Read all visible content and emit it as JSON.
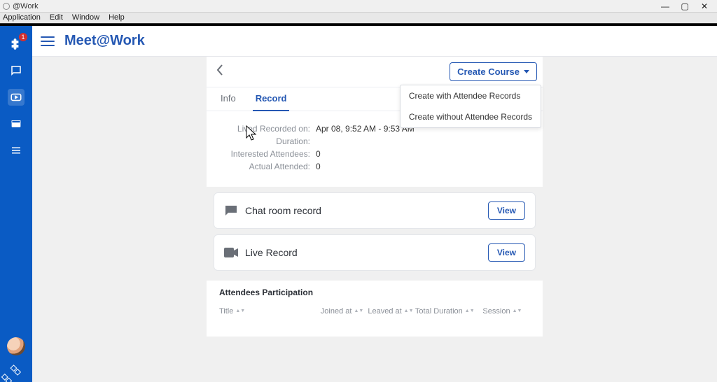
{
  "window": {
    "title": "@Work"
  },
  "menu": {
    "items": [
      "Application",
      "Edit",
      "Window",
      "Help"
    ]
  },
  "leftbar": {
    "badge": "1"
  },
  "header": {
    "brand": "Meet@Work"
  },
  "panel": {
    "create_label": "Create Course",
    "dropdown": {
      "opt1": "Create with Attendee Records",
      "opt2": "Create without Attendee Records"
    },
    "tabs": {
      "info": "Info",
      "record": "Record"
    },
    "info": {
      "recorded_label": "Lived Recorded on:",
      "recorded_value": "Apr 08, 9:52 AM - 9:53 AM",
      "duration_label": "Duration:",
      "duration_value": "",
      "interested_label": "Interested Attendees:",
      "interested_value": "0",
      "attended_label": "Actual Attended:",
      "attended_value": "0"
    },
    "cards": {
      "chat": {
        "title": "Chat room record",
        "btn": "View"
      },
      "live": {
        "title": "Live Record",
        "btn": "View"
      }
    },
    "attendees": {
      "title": "Attendees Participation",
      "cols": {
        "title": "Title",
        "joined": "Joined at",
        "leaved": "Leaved at",
        "duration": "Total Duration",
        "session": "Session"
      }
    }
  }
}
